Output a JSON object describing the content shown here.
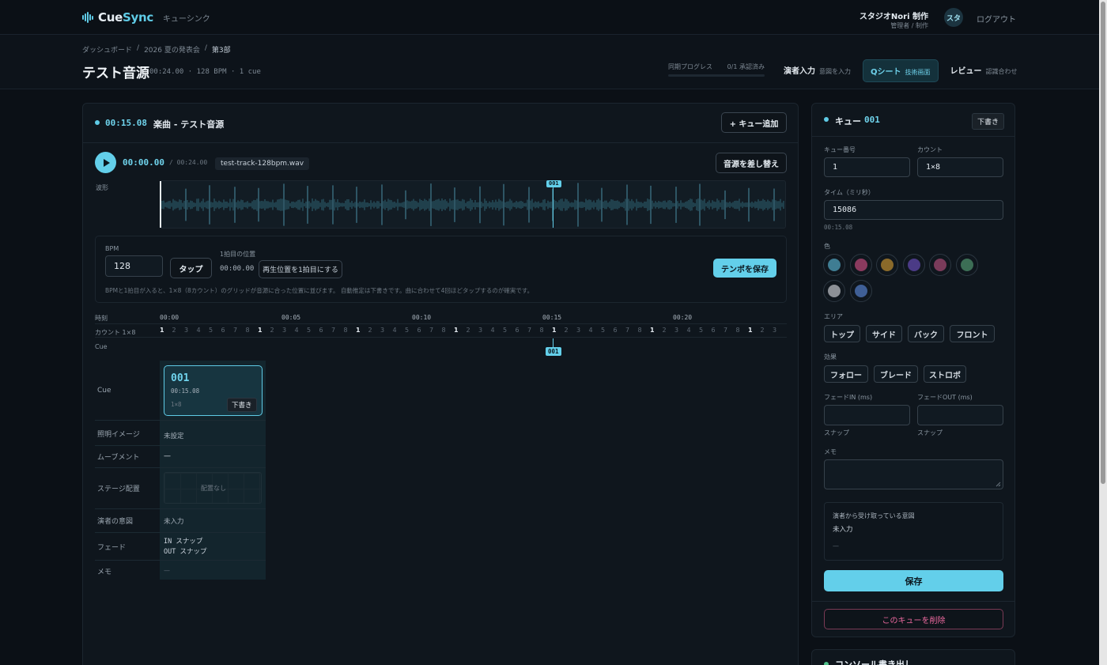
{
  "app": {
    "logo_a": "Cue",
    "logo_b": "Sync",
    "subtitle": "キューシンク"
  },
  "user": {
    "name": "スタジオNori 制作",
    "role": "管理者 / 制作",
    "avatar": "スタ",
    "logout": "ログアウト"
  },
  "breadcrumb": {
    "items": [
      "ダッシュボード",
      "2026 夏の発表会",
      "第3部"
    ],
    "sep": "/"
  },
  "page": {
    "title": "テスト音源",
    "meta": "00:24.00 · 128 BPM · 1 cue"
  },
  "progress": {
    "label": "同期プログレス",
    "value": "0/1 承認済み",
    "fraction": 0.0
  },
  "tabs": [
    {
      "title": "演者入力",
      "sub": "意図を入力",
      "active": false
    },
    {
      "title": "Qシート",
      "sub": "技術画面",
      "active": true
    },
    {
      "title": "レビュー",
      "sub": "認識合わせ",
      "active": false
    }
  ],
  "main": {
    "cue_time": "00:15.08",
    "cue_title": "楽曲 - テスト音源",
    "add_cue": "+ キュー追加",
    "playhead": "00:00.00",
    "duration": "/ 00:24.00",
    "file": "test-track-128bpm.wav",
    "replace": "音源を差し替え",
    "wave_label": "波形",
    "wave_marker": "001"
  },
  "tempo": {
    "bpm_label": "BPM",
    "bpm_value": "128",
    "tap": "タップ",
    "first_beat_label": "1拍目の位置",
    "first_beat_value": "00:00.00",
    "set_first": "再生位置を1拍目にする",
    "save": "テンポを保存",
    "help": "BPMと1拍目が入ると、1×8（8カウント）のグリッドが音源に合った位置に並びます。 自動推定は下書きです。曲に合わせて4回ほどタップするのが確実です。"
  },
  "timeline": {
    "time_label": "時刻",
    "count_label": "カウント 1×8",
    "cue_label": "Cue",
    "ticks": [
      "00:00",
      "00:05",
      "00:10",
      "00:15",
      "00:20"
    ],
    "marker": "001"
  },
  "grid": {
    "rows": [
      "Cue",
      "照明イメージ",
      "ムーブメント",
      "ステージ配置",
      "演者の意図",
      "フェード",
      "メモ"
    ],
    "card": {
      "number": "001",
      "time": "00:15.08",
      "count": "1×8",
      "status": "下書き"
    },
    "lighting": "未設定",
    "movement": "—",
    "stage": "配置なし",
    "intent": "未入力",
    "fade_in": "IN スナップ",
    "fade_out": "OUT スナップ",
    "memo": "—"
  },
  "editor": {
    "title": "キュー",
    "number": "001",
    "status": "下書き",
    "cue_no_label": "キュー番号",
    "cue_no": "1",
    "count_label": "カウント",
    "count": "1×8",
    "time_label": "タイム（ミリ秒）",
    "time_ms": "15086",
    "time_fmt": "00:15.08",
    "color_label": "色",
    "colors": [
      "#3f7d93",
      "#8a3a5e",
      "#8a6a2a",
      "#4b3b86",
      "#7a3b5a",
      "#3c6e55",
      "#8c9096",
      "#3f5f96"
    ],
    "area_label": "エリア",
    "areas": [
      "トップ",
      "サイド",
      "バック",
      "フロント"
    ],
    "effect_label": "効果",
    "effects": [
      "フォロー",
      "ブレード",
      "ストロボ"
    ],
    "fade_in_label": "フェードIN (ms)",
    "fade_out_label": "フェードOUT (ms)",
    "fade_in_hint": "スナップ",
    "fade_out_hint": "スナップ",
    "memo_label": "メモ",
    "intent_title": "演者から受け取っている意図",
    "intent_value": "未入力",
    "intent_extra": "—",
    "save": "保存",
    "delete": "このキューを削除"
  },
  "console": {
    "title": "コンソール書き出し"
  }
}
